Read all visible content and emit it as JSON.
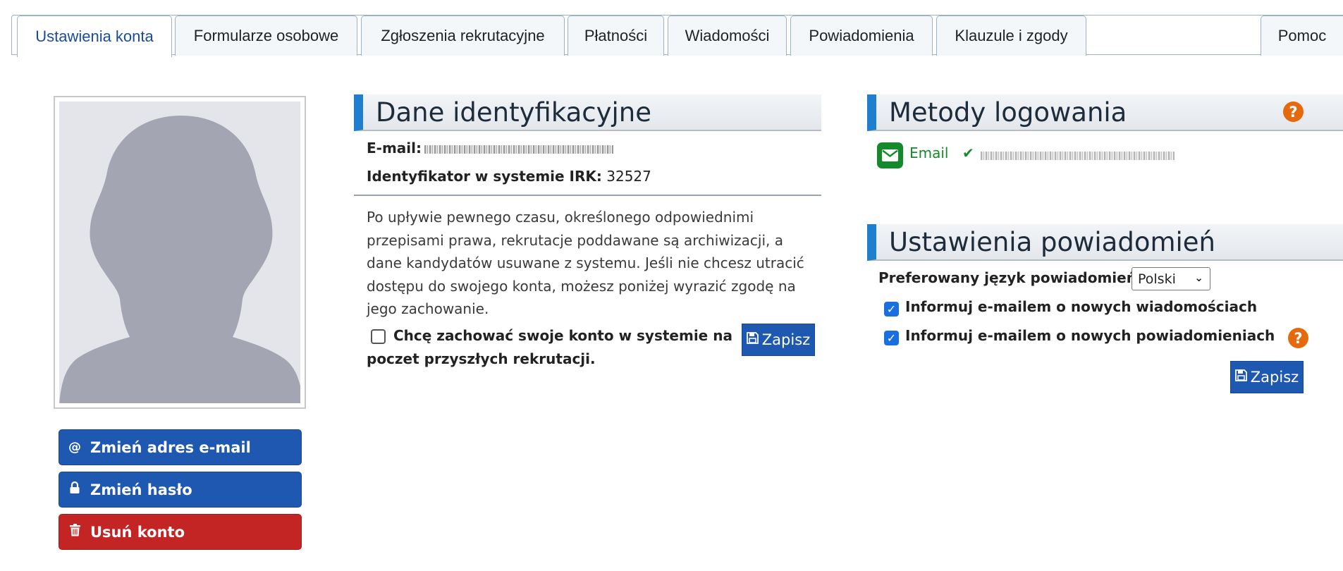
{
  "tabs": [
    {
      "label": "Ustawienia konta",
      "active": true
    },
    {
      "label": "Formularze osobowe"
    },
    {
      "label": "Zgłoszenia rekrutacyjne"
    },
    {
      "label": "Płatności"
    },
    {
      "label": "Wiadomości"
    },
    {
      "label": "Powiadomienia"
    },
    {
      "label": "Klauzule i zgody"
    },
    {
      "label": "Pomoc"
    }
  ],
  "account_actions": {
    "change_email": "Zmień adres e-mail",
    "change_password": "Zmień hasło",
    "delete_account": "Usuń konto"
  },
  "identification": {
    "title": "Dane identyfikacyjne",
    "email_label": "E-mail:",
    "irk_label": "Identyfikator w systemie IRK:",
    "irk_value": "32527",
    "archive_note": "Po upływie pewnego czasu, określonego odpowiednimi przepisami prawa, rekrutacje poddawane są archiwizacji, a dane kandydatów usuwane z systemu. Jeśli nie chcesz utracić dostępu do swojego konta, możesz poniżej wyrazić zgodę na jego zachowanie.",
    "keep_account_label": "Chcę zachować swoje konto w systemie na poczet przyszłych rekrutacji.",
    "keep_account_checked": false,
    "save_label": "Zapisz"
  },
  "login_methods": {
    "title": "Metody logowania",
    "email_method_label": "Email"
  },
  "notifications": {
    "title": "Ustawienia powiadomień",
    "language_label": "Preferowany język powiadomień:",
    "language_value": "Polski",
    "notify_messages_label": "Informuj e-mailem o nowych wiadomościach",
    "notify_messages_checked": true,
    "notify_notifications_label": "Informuj e-mailem o nowych powiadomieniach",
    "notify_notifications_checked": true,
    "save_label": "Zapisz"
  },
  "icons": {
    "help": "question-circle-icon",
    "email": "envelope-icon",
    "verified": "check-icon",
    "save": "floppy-disk-icon",
    "at": "at-icon",
    "lock": "lock-icon",
    "trash": "trash-icon"
  },
  "colors": {
    "primary_button": "#1f58b0",
    "danger_button": "#c32525",
    "section_accent": "#1e7fcf",
    "help_icon": "#e56a0d",
    "login_green": "#148a2c"
  }
}
